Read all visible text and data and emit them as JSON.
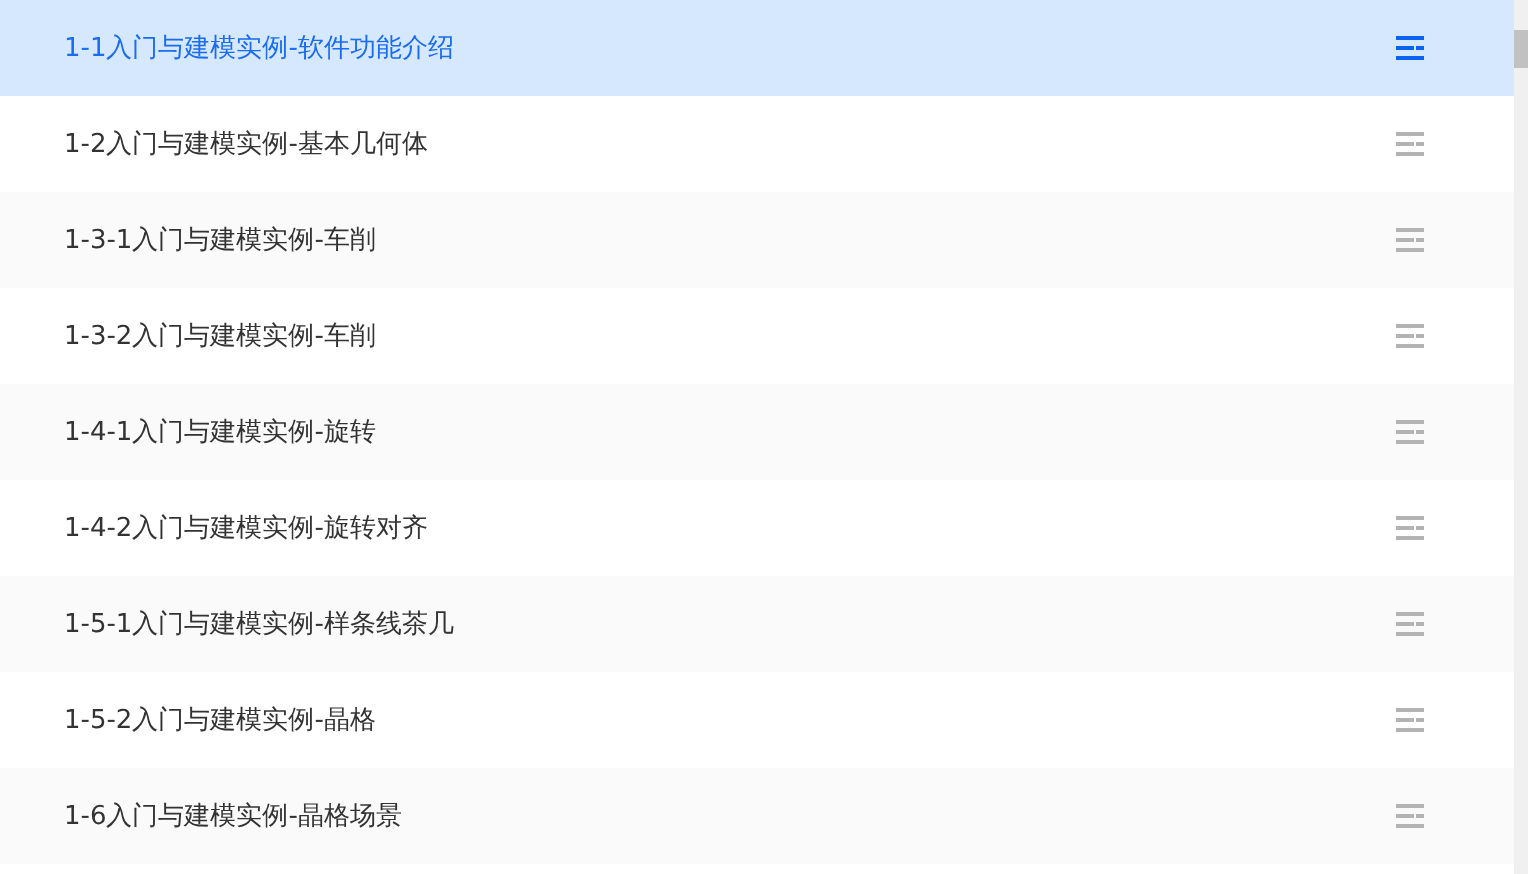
{
  "lessons": [
    {
      "title": "1-1入门与建模实例-软件功能介绍",
      "selected": true
    },
    {
      "title": "1-2入门与建模实例-基本几何体",
      "selected": false
    },
    {
      "title": "1-3-1入门与建模实例-车削",
      "selected": false
    },
    {
      "title": "1-3-2入门与建模实例-车削",
      "selected": false
    },
    {
      "title": "1-4-1入门与建模实例-旋转",
      "selected": false
    },
    {
      "title": "1-4-2入门与建模实例-旋转对齐",
      "selected": false
    },
    {
      "title": "1-5-1入门与建模实例-样条线茶几",
      "selected": false
    },
    {
      "title": "1-5-2入门与建模实例-晶格",
      "selected": false
    },
    {
      "title": "1-6入门与建模实例-晶格场景",
      "selected": false
    }
  ]
}
